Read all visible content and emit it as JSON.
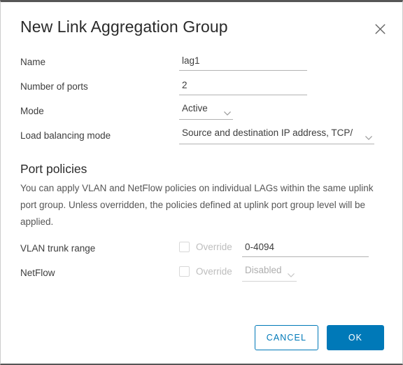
{
  "dialog": {
    "title": "New Link Aggregation Group",
    "close_icon": "close-icon"
  },
  "form": {
    "name": {
      "label": "Name",
      "value": "lag1",
      "placeholder": ""
    },
    "number_of_ports": {
      "label": "Number of ports",
      "value": "2",
      "placeholder": ""
    },
    "mode": {
      "label": "Mode",
      "value": "Active"
    },
    "load_balancing_mode": {
      "label": "Load balancing mode",
      "value": "Source and destination IP address, TCP/"
    }
  },
  "port_policies": {
    "heading": "Port policies",
    "description": "You can apply VLAN and NetFlow policies on individual LAGs within the same uplink port group. Unless overridden, the policies defined at uplink port group level will be applied.",
    "vlan_trunk_range": {
      "label": "VLAN trunk range",
      "override_label": "Override",
      "value": "0-4094",
      "placeholder": ""
    },
    "netflow": {
      "label": "NetFlow",
      "override_label": "Override",
      "value": "Disabled"
    }
  },
  "footer": {
    "cancel_label": "CANCEL",
    "ok_label": "OK"
  },
  "colors": {
    "accent": "#0079b8",
    "text": "#3d3d3d",
    "muted": "#bdbdbd",
    "border_top": "#565656"
  }
}
